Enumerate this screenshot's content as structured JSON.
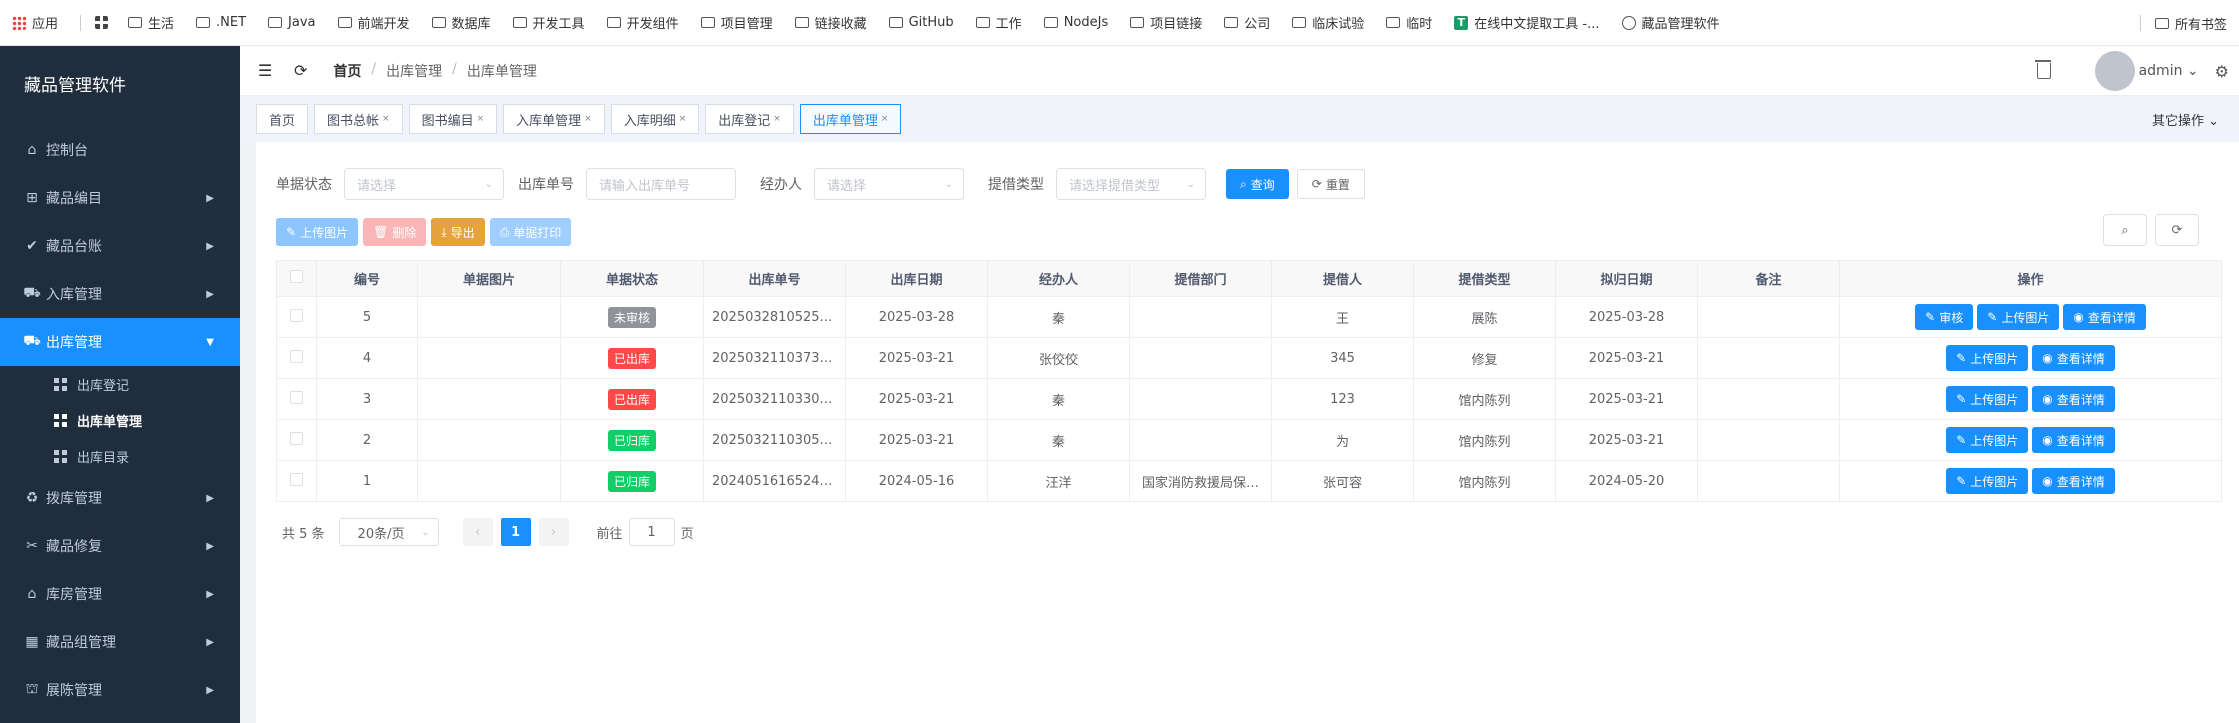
{
  "bookmarks": {
    "items": [
      "应用",
      "生活",
      ".NET",
      "Java",
      "前端开发",
      "数据库",
      "开发工具",
      "开发组件",
      "项目管理",
      "链接收藏",
      "GitHub",
      "工作",
      "NodeJs",
      "项目链接",
      "公司",
      "临床试验",
      "临时",
      "在线中文提取工具 -...",
      "藏品管理软件"
    ],
    "right": "所有书签"
  },
  "sidebar": {
    "title": "藏品管理软件",
    "items": [
      {
        "label": "控制台",
        "icon": "home-icon"
      },
      {
        "label": "藏品编目",
        "icon": "tree-icon"
      },
      {
        "label": "藏品台账",
        "icon": "check-circle-icon"
      },
      {
        "label": "入库管理",
        "icon": "truck-icon"
      },
      {
        "label": "出库管理",
        "icon": "truck-out-icon"
      },
      {
        "label": "拨库管理",
        "icon": "transfer-icon"
      },
      {
        "label": "藏品修复",
        "icon": "tools-icon"
      },
      {
        "label": "库房管理",
        "icon": "warehouse-icon"
      },
      {
        "label": "藏品组管理",
        "icon": "grid-icon"
      },
      {
        "label": "展陈管理",
        "icon": "exhibit-icon"
      }
    ],
    "sub_items": [
      "出库登记",
      "出库单管理",
      "出库目录"
    ]
  },
  "navbar": {
    "breadcrumb": [
      "首页",
      "出库管理",
      "出库单管理"
    ],
    "user": "admin"
  },
  "tags": [
    "首页",
    "图书总帐",
    "图书编目",
    "入库单管理",
    "入库明细",
    "出库登记",
    "出库单管理"
  ],
  "other_ops": "其它操作",
  "search": {
    "status_label": "单据状态",
    "status_placeholder": "请选择",
    "no_label": "出库单号",
    "no_placeholder": "请输入出库单号",
    "handler_label": "经办人",
    "handler_placeholder": "请选择",
    "type_label": "提借类型",
    "type_placeholder": "请选择提借类型",
    "query": "查询",
    "reset": "重置"
  },
  "toolbar": {
    "upload": "上传图片",
    "delete": "删除",
    "export": "导出",
    "print": "单据打印"
  },
  "table": {
    "headers": [
      "编号",
      "单据图片",
      "单据状态",
      "出库单号",
      "出库日期",
      "经办人",
      "提借部门",
      "提借人",
      "提借类型",
      "拟归日期",
      "备注",
      "操作"
    ],
    "rows": [
      {
        "id": "5",
        "status": "未审核",
        "status_color": "#909399",
        "no": "20250328105253…",
        "date": "2025-03-28",
        "handler": "秦",
        "dept": "",
        "borrower": "王",
        "type": "展陈",
        "return": "2025-03-28",
        "note": "",
        "ops": [
          "审核",
          "上传图片",
          "查看详情"
        ]
      },
      {
        "id": "4",
        "status": "已出库",
        "status_color": "#ff4949",
        "no": "20250321103734…",
        "date": "2025-03-21",
        "handler": "张佼佼",
        "dept": "",
        "borrower": "345",
        "type": "修复",
        "return": "2025-03-21",
        "note": "",
        "ops": [
          "上传图片",
          "查看详情"
        ]
      },
      {
        "id": "3",
        "status": "已出库",
        "status_color": "#ff4949",
        "no": "20250321103308…",
        "date": "2025-03-21",
        "handler": "秦",
        "dept": "",
        "borrower": "123",
        "type": "馆内陈列",
        "return": "2025-03-21",
        "note": "",
        "ops": [
          "上传图片",
          "查看详情"
        ]
      },
      {
        "id": "2",
        "status": "已归库",
        "status_color": "#13ce66",
        "no": "20250321103059…",
        "date": "2025-03-21",
        "handler": "秦",
        "dept": "",
        "borrower": "为",
        "type": "馆内陈列",
        "return": "2025-03-21",
        "note": "",
        "ops": [
          "上传图片",
          "查看详情"
        ]
      },
      {
        "id": "1",
        "status": "已归库",
        "status_color": "#13ce66",
        "no": "20240516165244…",
        "date": "2024-05-16",
        "handler": "汪洋",
        "dept": "国家消防救援局保…",
        "borrower": "张可容",
        "type": "馆内陈列",
        "return": "2024-05-20",
        "note": "",
        "ops": [
          "上传图片",
          "查看详情"
        ]
      }
    ]
  },
  "pager": {
    "total": "共 5 条",
    "size": "20条/页",
    "current": "1",
    "goto_label": "前往",
    "goto_value": "1",
    "page_unit": "页"
  }
}
